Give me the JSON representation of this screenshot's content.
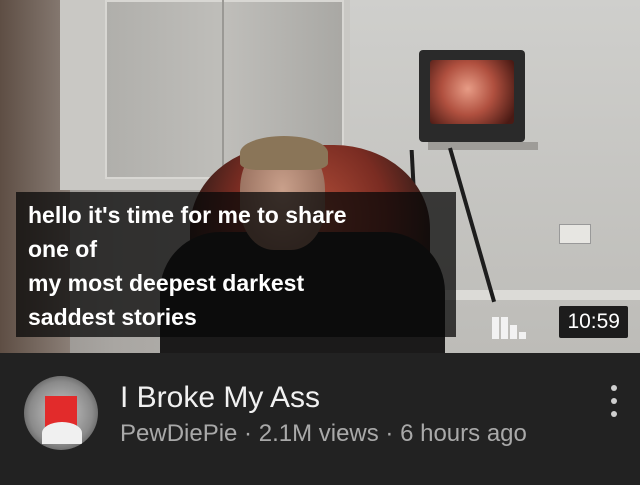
{
  "video": {
    "captions": [
      "hello it's time for me to share",
      "one of",
      "my most deepest darkest",
      "saddest stories"
    ],
    "duration": "10:59",
    "signal_icon": "signal-bars-icon",
    "title": "I Broke My Ass",
    "channel": "PewDiePie",
    "views": "2.1M views",
    "age": "6 hours ago",
    "separator": " · ",
    "menu_icon": "more-vert-icon"
  },
  "colors": {
    "background": "#202020",
    "title_text": "#f1f1f1",
    "meta_text": "#a9a9a9",
    "caption_text": "#ffffff"
  }
}
